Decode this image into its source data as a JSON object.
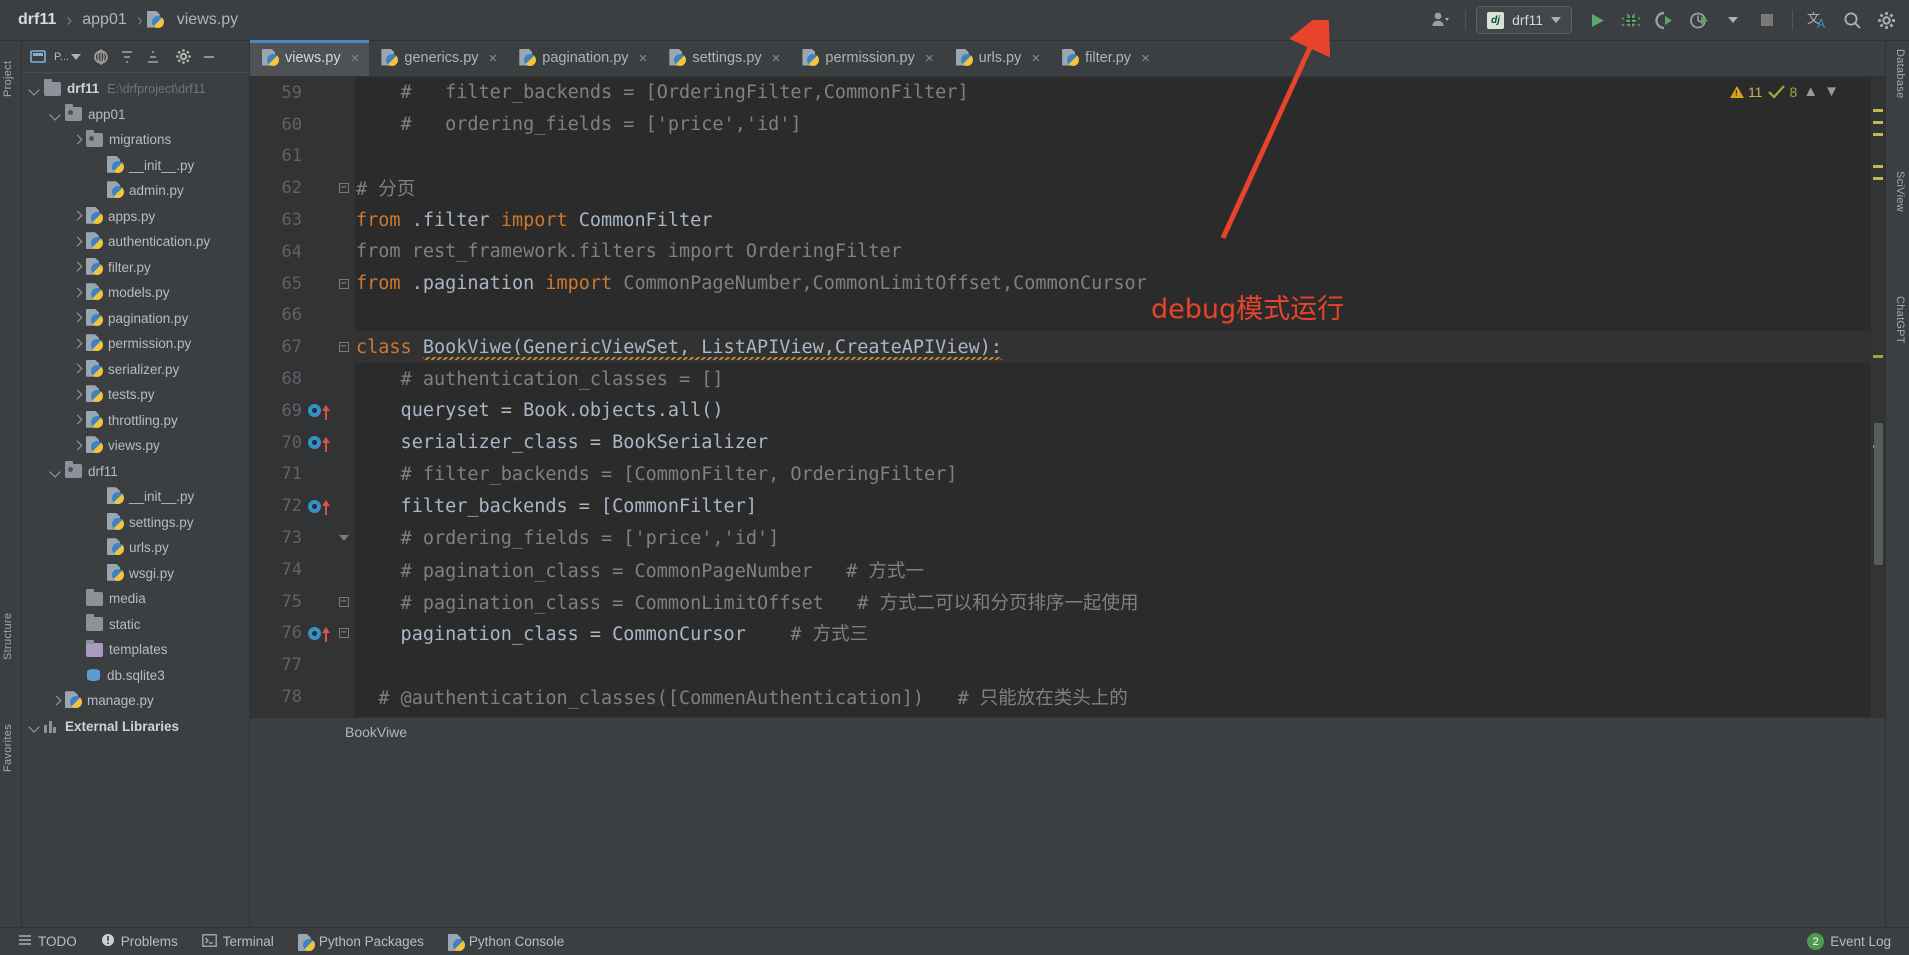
{
  "titlebar": {
    "breadcrumb": [
      {
        "label": "drf11",
        "bold": true
      },
      {
        "label": "app01",
        "bold": false
      },
      {
        "label": "views.py",
        "bold": false,
        "icon": "python-file-icon"
      }
    ],
    "separator": "›",
    "run_config": {
      "badge": "dj",
      "label": "drf11"
    },
    "buttons": [
      {
        "name": "run-button",
        "glyph": "run-icon"
      },
      {
        "name": "debug-button",
        "glyph": "bug-icon"
      },
      {
        "name": "run-with-coverage-button",
        "glyph": "coverage-icon"
      },
      {
        "name": "profile-button",
        "glyph": "profiler-icon"
      },
      {
        "name": "more-run-options-button",
        "glyph": "chevron-down-icon"
      },
      {
        "name": "stop-button",
        "glyph": "stop-icon"
      },
      {
        "name": "translate-button",
        "glyph": "translate-icon"
      },
      {
        "name": "search-everywhere-button",
        "glyph": "search-icon"
      },
      {
        "name": "settings-button",
        "glyph": "gear-icon"
      }
    ]
  },
  "left_strip": {
    "tabs": [
      {
        "name": "sidebar-tab-project",
        "label": "Project"
      },
      {
        "name": "sidebar-tab-structure",
        "label": "Structure"
      },
      {
        "name": "sidebar-tab-favorites",
        "label": "Favorites"
      }
    ]
  },
  "right_strip": {
    "tabs": [
      {
        "name": "right-tab-database",
        "label": "Database"
      },
      {
        "name": "right-tab-sciview",
        "label": "SciView"
      },
      {
        "name": "right-tab-chatgpt",
        "label": "ChatGPT"
      }
    ]
  },
  "project_panel": {
    "selector_label": "P...",
    "tree": [
      {
        "indent": 0,
        "arrow": "down",
        "icon": "folder",
        "label": "drf11",
        "bold": true,
        "path": "E:\\drfproject\\drf11"
      },
      {
        "indent": 1,
        "arrow": "down",
        "icon": "folder-source",
        "label": "app01"
      },
      {
        "indent": 2,
        "arrow": "right",
        "icon": "folder-source",
        "label": "migrations"
      },
      {
        "indent": 3,
        "arrow": "none",
        "icon": "python",
        "label": "__init__.py"
      },
      {
        "indent": 3,
        "arrow": "none",
        "icon": "python",
        "label": "admin.py"
      },
      {
        "indent": 2,
        "arrow": "right",
        "icon": "python",
        "label": "apps.py"
      },
      {
        "indent": 2,
        "arrow": "right",
        "icon": "python",
        "label": "authentication.py"
      },
      {
        "indent": 2,
        "arrow": "right",
        "icon": "python",
        "label": "filter.py"
      },
      {
        "indent": 2,
        "arrow": "right",
        "icon": "python",
        "label": "models.py"
      },
      {
        "indent": 2,
        "arrow": "right",
        "icon": "python",
        "label": "pagination.py"
      },
      {
        "indent": 2,
        "arrow": "right",
        "icon": "python",
        "label": "permission.py"
      },
      {
        "indent": 2,
        "arrow": "right",
        "icon": "python",
        "label": "serializer.py"
      },
      {
        "indent": 2,
        "arrow": "right",
        "icon": "python",
        "label": "tests.py"
      },
      {
        "indent": 2,
        "arrow": "right",
        "icon": "python",
        "label": "throttling.py"
      },
      {
        "indent": 2,
        "arrow": "right",
        "icon": "python",
        "label": "views.py"
      },
      {
        "indent": 1,
        "arrow": "down",
        "icon": "folder-source",
        "label": "drf11"
      },
      {
        "indent": 3,
        "arrow": "none",
        "icon": "python",
        "label": "__init__.py"
      },
      {
        "indent": 3,
        "arrow": "none",
        "icon": "python",
        "label": "settings.py"
      },
      {
        "indent": 3,
        "arrow": "none",
        "icon": "python",
        "label": "urls.py"
      },
      {
        "indent": 3,
        "arrow": "none",
        "icon": "python",
        "label": "wsgi.py"
      },
      {
        "indent": 2,
        "arrow": "none",
        "icon": "folder",
        "label": "media"
      },
      {
        "indent": 2,
        "arrow": "none",
        "icon": "folder",
        "label": "static"
      },
      {
        "indent": 2,
        "arrow": "none",
        "icon": "folder-template",
        "label": "templates"
      },
      {
        "indent": 2,
        "arrow": "none",
        "icon": "database",
        "label": "db.sqlite3"
      },
      {
        "indent": 1,
        "arrow": "right",
        "icon": "python",
        "label": "manage.py"
      },
      {
        "indent": 0,
        "arrow": "down",
        "icon": "library",
        "label": "External Libraries",
        "bold": true
      }
    ]
  },
  "editor_tabs": [
    {
      "label": "views.py",
      "active": true
    },
    {
      "label": "generics.py",
      "active": false
    },
    {
      "label": "pagination.py",
      "active": false
    },
    {
      "label": "settings.py",
      "active": false
    },
    {
      "label": "permission.py",
      "active": false
    },
    {
      "label": "urls.py",
      "active": false
    },
    {
      "label": "filter.py",
      "active": false
    }
  ],
  "inspections": {
    "warning_count": "11",
    "ok_count": "8"
  },
  "editor": {
    "lines": [
      {
        "num": "59",
        "breakpoint": false,
        "fold": "",
        "tokens": [
          {
            "t": "    # ",
            "c": "cmt"
          },
          {
            "t": "  filter_backends = [OrderingFilter,CommonFilter]",
            "c": "cmt"
          }
        ]
      },
      {
        "num": "60",
        "breakpoint": false,
        "fold": "",
        "tokens": [
          {
            "t": "    #   ordering_fields = ['price','id']",
            "c": "cmt"
          }
        ]
      },
      {
        "num": "61",
        "breakpoint": false,
        "fold": "",
        "tokens": []
      },
      {
        "num": "62",
        "breakpoint": false,
        "fold": "box-minus",
        "tokens": [
          {
            "t": "# 分页",
            "c": "cmt"
          }
        ]
      },
      {
        "num": "63",
        "breakpoint": false,
        "fold": "",
        "tokens": [
          {
            "t": "from ",
            "c": "kw"
          },
          {
            "t": ".filter ",
            "c": "txt"
          },
          {
            "t": "import ",
            "c": "kw"
          },
          {
            "t": "CommonFilter",
            "c": "txt"
          }
        ]
      },
      {
        "num": "64",
        "breakpoint": false,
        "fold": "",
        "tokens": [
          {
            "t": "from rest_framework.filters import OrderingFilter",
            "c": "cmt"
          }
        ]
      },
      {
        "num": "65",
        "breakpoint": false,
        "fold": "box-minus",
        "tokens": [
          {
            "t": "from ",
            "c": "kw"
          },
          {
            "t": ".pagination ",
            "c": "txt"
          },
          {
            "t": "import ",
            "c": "kw"
          },
          {
            "t": "CommonPageNumber,CommonLimitOffset,CommonCursor",
            "c": "cmt"
          }
        ]
      },
      {
        "num": "66",
        "breakpoint": false,
        "fold": "",
        "tokens": []
      },
      {
        "num": "67",
        "breakpoint": false,
        "fold": "box-minus",
        "highlight": true,
        "tokens": [
          {
            "t": "class ",
            "c": "kw"
          },
          {
            "t": "BookViwe(GenericViewSet, ListAPIView,CreateAPIView):",
            "c": "cls squig"
          }
        ]
      },
      {
        "num": "68",
        "breakpoint": false,
        "fold": "",
        "tokens": [
          {
            "t": "    # authentication_classes = []",
            "c": "cmt"
          }
        ]
      },
      {
        "num": "69",
        "breakpoint": true,
        "fold": "",
        "tokens": [
          {
            "t": "    queryset = Book.objects.all()",
            "c": "txt"
          }
        ]
      },
      {
        "num": "70",
        "breakpoint": true,
        "fold": "",
        "tokens": [
          {
            "t": "    serializer_class = BookSerializer",
            "c": "txt"
          }
        ]
      },
      {
        "num": "71",
        "breakpoint": false,
        "fold": "",
        "tokens": [
          {
            "t": "    # filter_backends = [CommonFilter, OrderingFilter]",
            "c": "cmt"
          }
        ]
      },
      {
        "num": "72",
        "breakpoint": true,
        "fold": "",
        "tokens": [
          {
            "t": "    filter_backends = [CommonFilter]",
            "c": "txt"
          }
        ]
      },
      {
        "num": "73",
        "breakpoint": false,
        "fold": "tri-down",
        "tokens": [
          {
            "t": "    # ordering_fields = ['price','id']",
            "c": "cmt"
          }
        ]
      },
      {
        "num": "74",
        "breakpoint": false,
        "fold": "",
        "tokens": [
          {
            "t": "    # pagination_class = CommonPageNumber   # 方式一",
            "c": "cmt"
          }
        ]
      },
      {
        "num": "75",
        "breakpoint": false,
        "fold": "box-minus",
        "tokens": [
          {
            "t": "    # pagination_class = CommonLimitOffset   # 方式二可以和分页排序一起使用",
            "c": "cmt"
          }
        ]
      },
      {
        "num": "76",
        "breakpoint": true,
        "fold": "box-minus",
        "tokens": [
          {
            "t": "    pagination_class = CommonCursor",
            "c": "txt"
          },
          {
            "t": "    # 方式三",
            "c": "cmt"
          }
        ]
      },
      {
        "num": "77",
        "breakpoint": false,
        "fold": "",
        "tokens": []
      },
      {
        "num": "78",
        "breakpoint": false,
        "fold": "",
        "tokens": [
          {
            "t": "  # @authentication_classes([CommenAuthentication])   # 只能放在类头上的",
            "c": "cmt"
          }
        ]
      }
    ]
  },
  "annotation": {
    "text": "debug模式运行",
    "color": "#e8432b"
  },
  "editor_footer": {
    "breadcrumb": "BookViwe"
  },
  "statusbar": {
    "left_items": [
      {
        "name": "status-todo",
        "label": "TODO",
        "icon": "list-icon"
      },
      {
        "name": "status-problems",
        "label": "Problems",
        "icon": "error-circle-icon"
      },
      {
        "name": "status-terminal",
        "label": "Terminal",
        "icon": "terminal-icon"
      },
      {
        "name": "status-python-packages",
        "label": "Python Packages",
        "icon": "python-icon"
      },
      {
        "name": "status-python-console",
        "label": "Python Console",
        "icon": "python-icon"
      }
    ],
    "right_items": [
      {
        "name": "status-event-log",
        "label": "Event Log",
        "badge": "2"
      }
    ]
  }
}
